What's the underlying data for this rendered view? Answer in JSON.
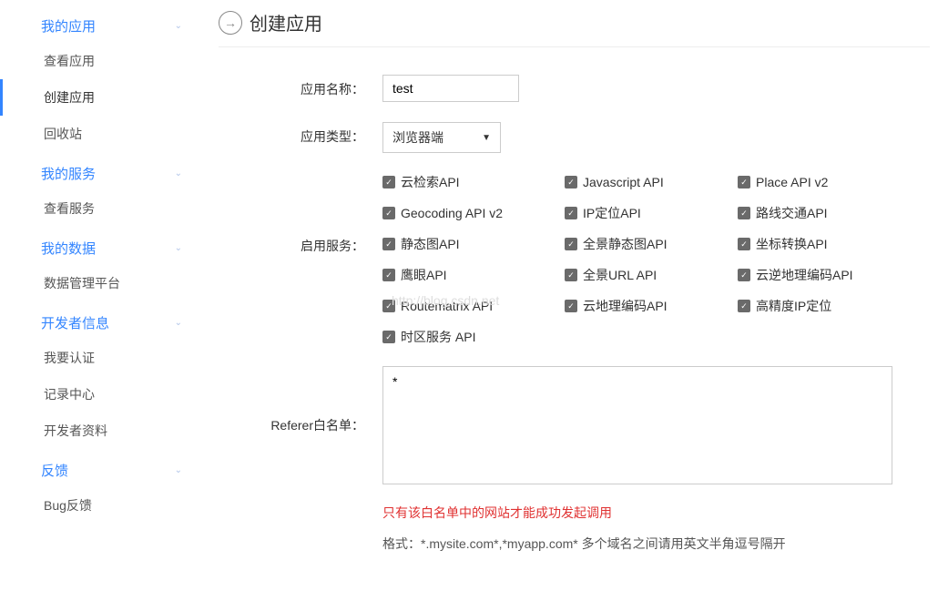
{
  "sidebar": {
    "groups": [
      {
        "title": "我的应用",
        "items": [
          {
            "label": "查看应用"
          },
          {
            "label": "创建应用",
            "active": true
          },
          {
            "label": "回收站"
          }
        ]
      },
      {
        "title": "我的服务",
        "items": [
          {
            "label": "查看服务"
          }
        ]
      },
      {
        "title": "我的数据",
        "items": [
          {
            "label": "数据管理平台"
          }
        ]
      },
      {
        "title": "开发者信息",
        "items": [
          {
            "label": "我要认证"
          },
          {
            "label": "记录中心"
          },
          {
            "label": "开发者资料"
          }
        ]
      },
      {
        "title": "反馈",
        "items": [
          {
            "label": "Bug反馈"
          }
        ]
      }
    ]
  },
  "page": {
    "title": "创建应用"
  },
  "form": {
    "app_name_label": "应用名称：",
    "app_name_value": "test",
    "app_type_label": "应用类型：",
    "app_type_value": "浏览器端",
    "services_label": "启用服务：",
    "services": [
      "云检索API",
      "Javascript API",
      "Place API v2",
      "Geocoding API v2",
      "IP定位API",
      "路线交通API",
      "静态图API",
      "全景静态图API",
      "坐标转换API",
      "鹰眼API",
      "全景URL API",
      "云逆地理编码API",
      "Routematrix API",
      "云地理编码API",
      "高精度IP定位",
      "时区服务 API"
    ],
    "referer_label": "Referer白名单：",
    "referer_value": "*",
    "warning": "只有该白名单中的网站才能成功发起调用",
    "hint": "格式：*.mysite.com*,*myapp.com* 多个域名之间请用英文半角逗号隔开"
  },
  "watermark": "http://blog.csdn.net"
}
